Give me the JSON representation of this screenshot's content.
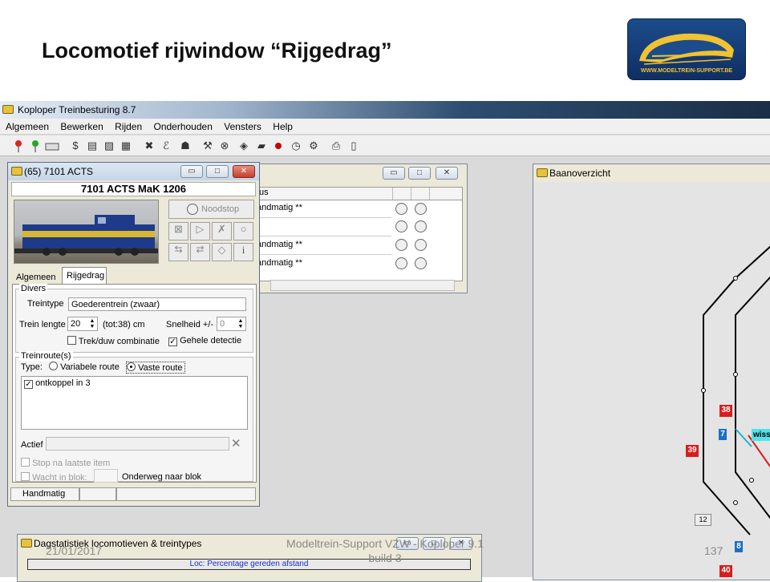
{
  "slide": {
    "title": "Locomotief rijwindow “Rijgedrag”",
    "footer_date": "21/01/2017",
    "footer_center": "Modeltrein-Support  VZW - Koploper 9.1 build 3",
    "page_number": "137",
    "logo_url": "WWW.MODELTREIN-SUPPORT.BE"
  },
  "app": {
    "title": "Koploper Treinbesturing 8.7",
    "menu": [
      "Algemeen",
      "Bewerken",
      "Rijden",
      "Onderhouden",
      "Vensters",
      "Help"
    ]
  },
  "loco_window": {
    "title": "(65) 7101 ACTS",
    "loco_name": "7101 ACTS MaK 1206",
    "noodstop": "Noodstop",
    "tabs": [
      "Algemeen",
      "Rijgedrag"
    ],
    "divers": {
      "group": "Divers",
      "treintype_label": "Treintype",
      "treintype_value": "Goederentrein (zwaar)",
      "lengte_label": "Trein lengte",
      "lengte_value": "20",
      "lengte_tot": "(tot:38) cm",
      "snelheid_label": "Snelheid +/-",
      "snelheid_value": "0",
      "trek_label": "Trek/duw combinatie",
      "gehele_label": "Gehele  detectie"
    },
    "route": {
      "group": "Treinroute(s)",
      "type_label": "Type:",
      "variabele": "Variabele route",
      "vaste": "Vaste route",
      "items": [
        "ontkoppel in 3"
      ],
      "actief_label": "Actief",
      "stop_label": "Stop na laatste item",
      "wacht_label": "Wacht in blok:",
      "onderweg_label": "Onderweg naar blok"
    },
    "status": "Handmatig"
  },
  "status_window": {
    "header": "tus",
    "rows": [
      "andmatig **",
      "",
      "andmatig **",
      "andmatig **"
    ]
  },
  "baan": {
    "title": "Baanoverzicht",
    "blocks": [
      "38",
      "39",
      "40",
      "7",
      "8",
      "12"
    ],
    "wiss": "wiss"
  },
  "stats": {
    "title": "Dagstatistiek locomotieven & treintypes",
    "bar_label": "Loc: Percentage gereden afstand"
  }
}
